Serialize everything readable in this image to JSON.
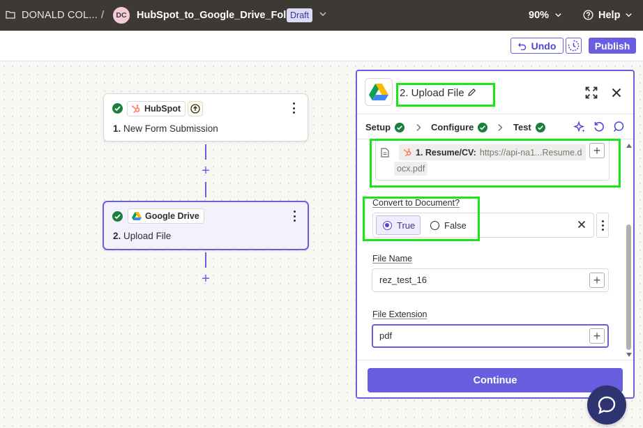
{
  "topbar": {
    "folder_name": "DONALD COL...",
    "separator": "/",
    "avatar_initials": "DC",
    "zap_name": "HubSpot_to_Google_Drive_Folder",
    "status_badge": "Draft",
    "zoom": "90%",
    "help_label": "Help"
  },
  "actionbar": {
    "undo_label": "Undo",
    "publish_label": "Publish"
  },
  "canvas": {
    "steps": [
      {
        "app": "HubSpot",
        "number": "1.",
        "title": "New Form Submission",
        "status": "complete"
      },
      {
        "app": "Google Drive",
        "number": "2.",
        "title": "Upload File",
        "status": "complete"
      }
    ],
    "add_symbol": "+"
  },
  "panel": {
    "title": "2. Upload File",
    "tabs": [
      {
        "label": "Setup",
        "status": "complete"
      },
      {
        "label": "Configure",
        "status": "complete"
      },
      {
        "label": "Test",
        "status": "complete"
      }
    ],
    "file_field": {
      "pill_step": "1. Resume/CV:",
      "pill_value": "https://api-na1...Resume.d",
      "pill_value_cont": "ocx.pdf"
    },
    "convert": {
      "label": "Convert to Document?",
      "options": [
        "True",
        "False"
      ],
      "selected": "True"
    },
    "file_name": {
      "label": "File Name",
      "value": "rez_test_16"
    },
    "file_extension": {
      "label": "File Extension",
      "value": "pdf"
    },
    "continue_label": "Continue"
  },
  "colors": {
    "accent": "#6a5ee0",
    "topbar_bg": "#3d3935",
    "success": "#1a7f3c",
    "highlight_box": "#19e619",
    "chat_bubble": "#2e3470"
  }
}
